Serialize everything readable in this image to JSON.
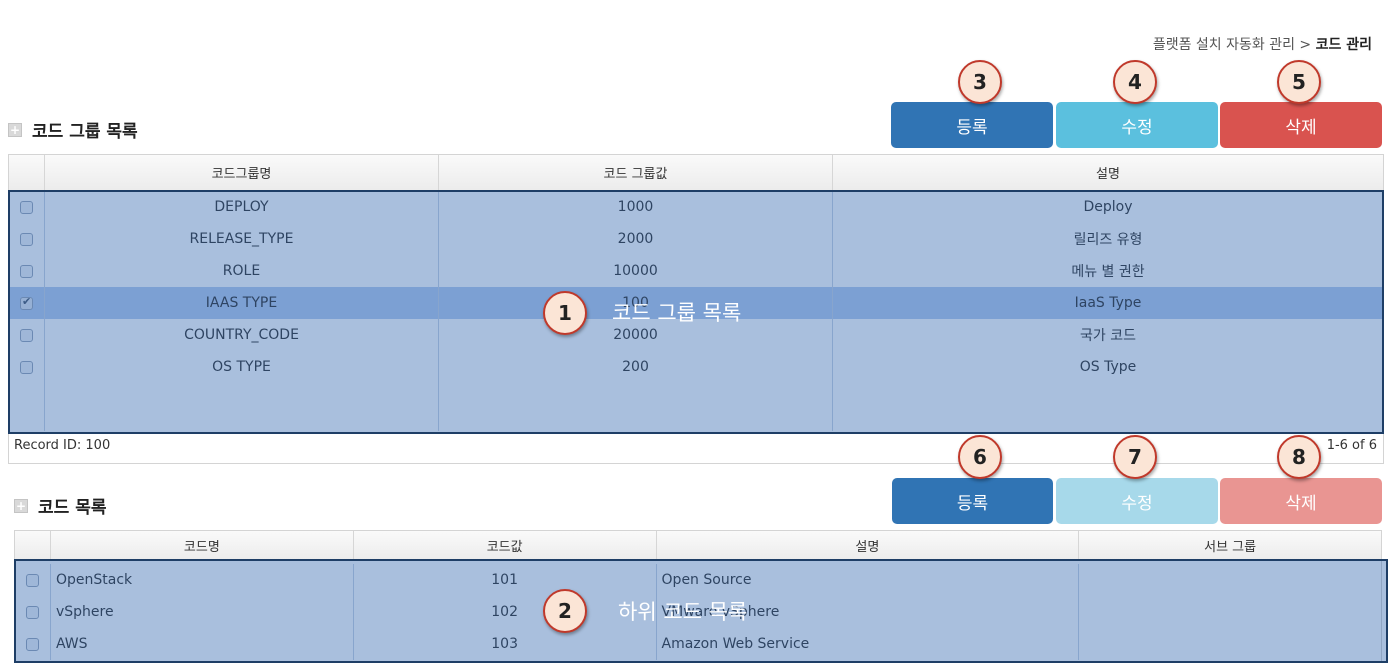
{
  "breadcrumb": {
    "path": "플랫폼 설치 자동화 관리 > ",
    "current": "코드 관리"
  },
  "group_section": {
    "title": "코드 그룹 목록",
    "buttons": {
      "register": "등록",
      "edit": "수정",
      "delete": "삭제"
    },
    "columns": [
      "코드그룹명",
      "코드 그룹값",
      "설명"
    ],
    "rows": [
      {
        "name": "DEPLOY",
        "value": "1000",
        "desc": "Deploy",
        "checked": false
      },
      {
        "name": "RELEASE_TYPE",
        "value": "2000",
        "desc": "릴리즈 유형",
        "checked": false
      },
      {
        "name": "ROLE",
        "value": "10000",
        "desc": "메뉴 별 권한",
        "checked": false
      },
      {
        "name": "IAAS TYPE",
        "value": "100",
        "desc": "IaaS Type",
        "checked": true
      },
      {
        "name": "COUNTRY_CODE",
        "value": "20000",
        "desc": "국가 코드",
        "checked": false
      },
      {
        "name": "OS TYPE",
        "value": "200",
        "desc": "OS Type",
        "checked": false
      }
    ],
    "record_id": "Record ID: 100",
    "paging": "1-6 of 6"
  },
  "code_section": {
    "title": "코드 목록",
    "buttons": {
      "register": "등록",
      "edit": "수정",
      "delete": "삭제"
    },
    "columns": [
      "코드명",
      "코드값",
      "설명",
      "서브 그룹"
    ],
    "rows": [
      {
        "name": "OpenStack",
        "value": "101",
        "desc": "Open Source",
        "sub": ""
      },
      {
        "name": "vSphere",
        "value": "102",
        "desc": "VMware vSphere",
        "sub": ""
      },
      {
        "name": "AWS",
        "value": "103",
        "desc": "Amazon Web Service",
        "sub": ""
      }
    ]
  },
  "annotations": {
    "m1": "1",
    "m2": "2",
    "m3": "3",
    "m4": "4",
    "m5": "5",
    "m6": "6",
    "m7": "7",
    "m8": "8",
    "label1": "코드 그룹 목록",
    "label2": "하위 코드 목록"
  },
  "colors": {
    "primary": "#3074b4",
    "info": "#5bc0de",
    "danger": "#d9534f",
    "overlay": "#285faa",
    "marker_fill": "#fbe5d6",
    "marker_border": "#c0392b"
  }
}
